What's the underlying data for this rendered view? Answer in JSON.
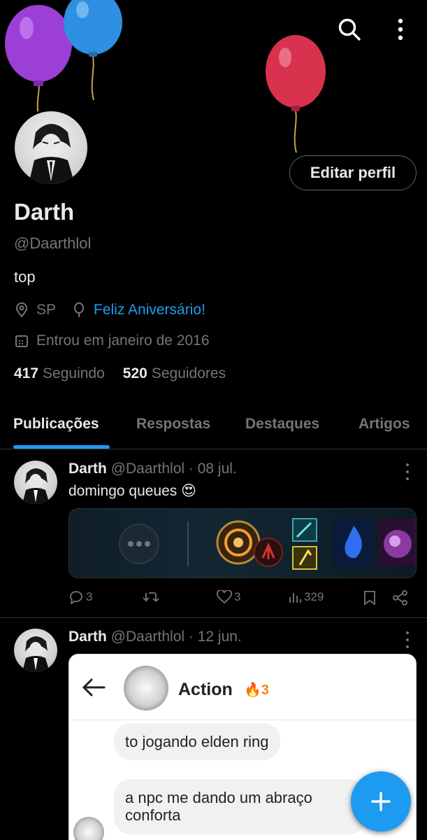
{
  "profile": {
    "name": "Darth",
    "handle": "@Daarthlol",
    "bio": "top",
    "location": "SP",
    "birthday_link": "Feliz Aniversário!",
    "joined": "Entrou em janeiro de 2016",
    "following_count": "417",
    "following_label": "Seguindo",
    "followers_count": "520",
    "followers_label": "Seguidores",
    "edit_button": "Editar perfil"
  },
  "tabs": [
    {
      "label": "Publicações",
      "active": true
    },
    {
      "label": "Respostas",
      "active": false
    },
    {
      "label": "Destaques",
      "active": false
    },
    {
      "label": "Artigos",
      "active": false
    }
  ],
  "posts": [
    {
      "name": "Darth",
      "handle_date": "@Daarthlol · 08 jul.",
      "text": "domingo queues 😍",
      "replies": "3",
      "likes": "3",
      "views": "329"
    },
    {
      "name": "Darth",
      "handle_date": "@Daarthlol · 12 jun.",
      "chat": {
        "title": "Action",
        "streak": "3",
        "msg1": "to jogando elden ring",
        "msg2_line1": "a npc me dando um abraço",
        "msg2_line2": "conforta"
      }
    }
  ],
  "colors": {
    "accent": "#1d9bf0",
    "text": "#e7e9ea",
    "muted": "#71767b",
    "background": "#000000"
  },
  "icons": [
    "search-icon",
    "more-vertical-icon",
    "location-icon",
    "balloon-icon",
    "calendar-icon",
    "reply-icon",
    "repost-icon",
    "like-icon",
    "views-icon",
    "bookmark-icon",
    "share-icon",
    "back-arrow-icon",
    "fire-icon",
    "plus-icon"
  ]
}
